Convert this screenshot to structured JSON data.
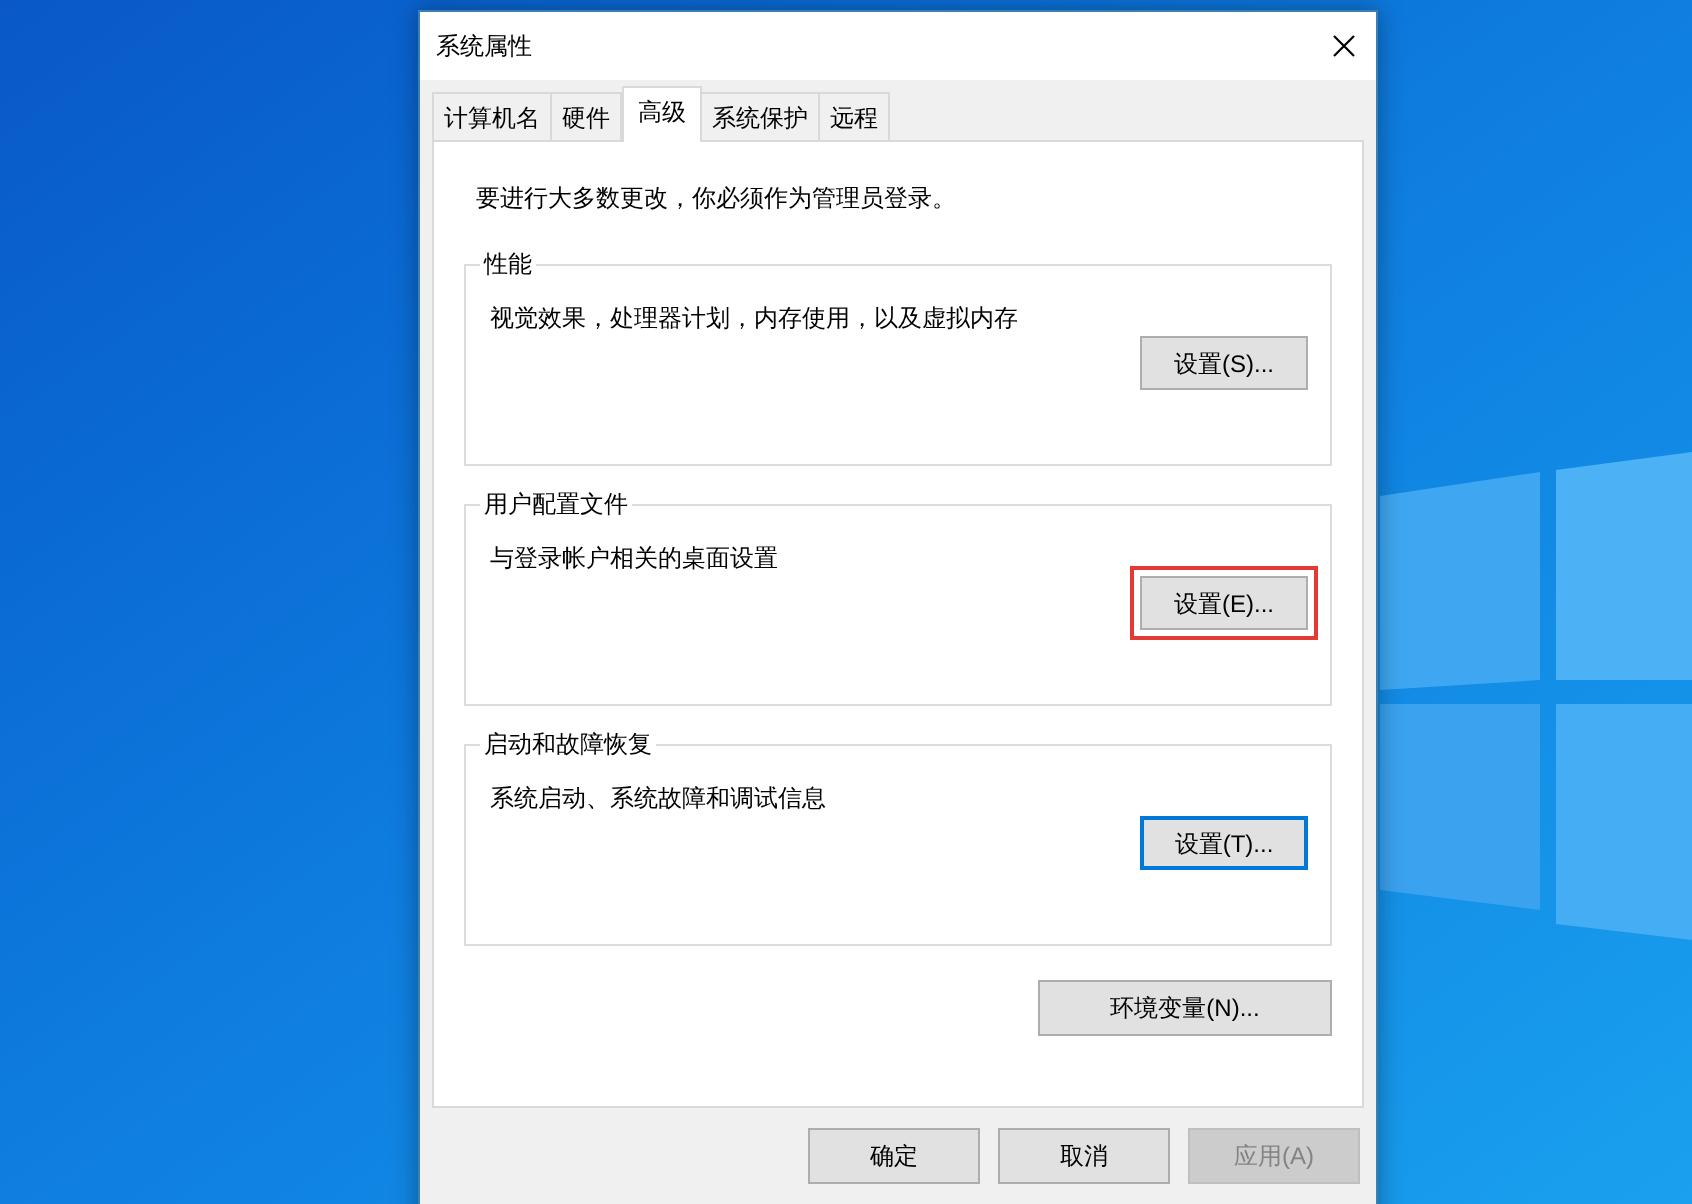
{
  "window": {
    "title": "系统属性"
  },
  "tabs": [
    {
      "label": "计算机名",
      "selected": false
    },
    {
      "label": "硬件",
      "selected": false
    },
    {
      "label": "高级",
      "selected": true
    },
    {
      "label": "系统保护",
      "selected": false
    },
    {
      "label": "远程",
      "selected": false
    }
  ],
  "notice": "要进行大多数更改，你必须作为管理员登录。",
  "groups": [
    {
      "title": "性能",
      "description": "视觉效果，处理器计划，内存使用，以及虚拟内存",
      "button": {
        "label": "设置(S)...",
        "focused": false,
        "highlighted": false
      }
    },
    {
      "title": "用户配置文件",
      "description": "与登录帐户相关的桌面设置",
      "button": {
        "label": "设置(E)...",
        "focused": false,
        "highlighted": true
      }
    },
    {
      "title": "启动和故障恢复",
      "description": "系统启动、系统故障和调试信息",
      "button": {
        "label": "设置(T)...",
        "focused": true,
        "highlighted": false
      }
    }
  ],
  "env_button": {
    "label": "环境变量(N)..."
  },
  "dialog_buttons": [
    {
      "label": "确定",
      "disabled": false
    },
    {
      "label": "取消",
      "disabled": false
    },
    {
      "label": "应用(A)",
      "disabled": true
    }
  ]
}
